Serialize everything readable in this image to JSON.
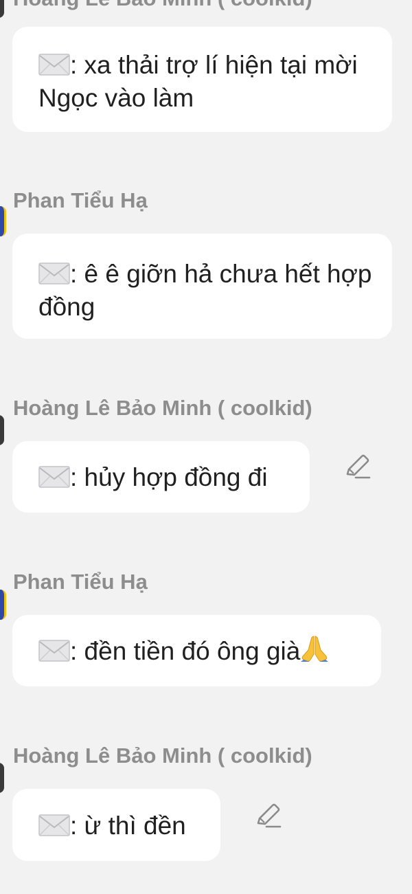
{
  "messages": [
    {
      "sender": "Hoàng Lê Bảo Minh ( coolkid)",
      "text": ": xa thải trợ lí hiện tại mời Ngọc vào làm",
      "editable": false
    },
    {
      "sender": "Phan Tiểu Hạ",
      "text": ": ê ê giỡn hả chưa hết hợp đồng",
      "editable": false
    },
    {
      "sender": "Hoàng Lê Bảo Minh ( coolkid)",
      "text": ": hủy hợp đồng đi",
      "editable": true
    },
    {
      "sender": "Phan Tiểu Hạ",
      "text": ": đền tiền đó ông già",
      "editable": false,
      "trailing_emoji": "folded-hands"
    },
    {
      "sender": "Hoàng Lê Bảo Minh ( coolkid)",
      "text": ": ừ thì đền",
      "editable": true
    }
  ],
  "icons": {
    "message_prefix": "envelope-icon",
    "edit": "pencil-icon"
  },
  "colors": {
    "background": "#f2f2f2",
    "bubble": "#ffffff",
    "sender_name": "#8d8d8d",
    "message_text": "#202020",
    "icon_gray": "#8a8a8a"
  }
}
